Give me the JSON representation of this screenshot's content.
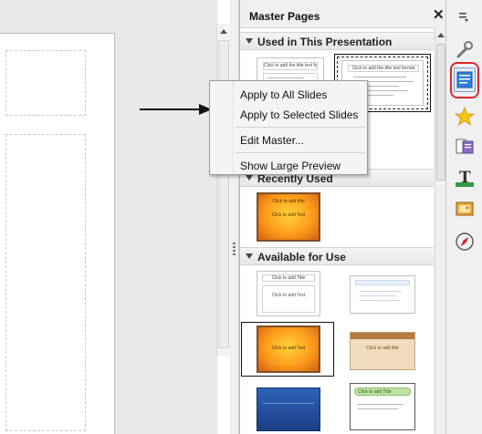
{
  "panel": {
    "title": "Master Pages",
    "close_glyph": "✕",
    "sections": [
      {
        "label": "Used in This Presentation"
      },
      {
        "label": "Recently Used"
      },
      {
        "label": "Available for Use"
      }
    ]
  },
  "thumbnails": {
    "title_text": "Click to add the title text format",
    "outline_text": "Click to add Title",
    "content_text": "Click to add Text",
    "orange_title": "Click to add title",
    "orange_text": "Click to add Text",
    "green_title": "Click to add Title"
  },
  "context_menu": {
    "items": [
      {
        "label": "Apply to All Slides"
      },
      {
        "label": "Apply to Selected Slides"
      },
      {
        "label": "Edit Master..."
      },
      {
        "label": "Show Large Preview"
      }
    ]
  },
  "sidebar_deck": {
    "buttons": [
      "properties-icon",
      "slide-transition-icon",
      "master-pages-icon",
      "custom-animation-icon",
      "styles-icon",
      "gallery-icon",
      "navigator-icon"
    ],
    "active": "master-pages-icon",
    "highlight_color": "#d9262c"
  },
  "colors": {
    "accent_blue": "#2f7ed8",
    "highlight_red": "#d9262c"
  }
}
